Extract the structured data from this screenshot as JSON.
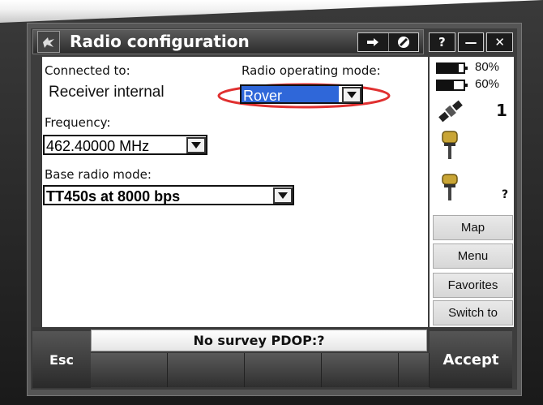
{
  "window": {
    "title": "Radio configuration",
    "status_icons": [
      "forward-arrow-icon",
      "no-entry-icon"
    ],
    "buttons": [
      "?",
      "—",
      "✕"
    ]
  },
  "fields": {
    "connected_to_label": "Connected to:",
    "connected_to_value": "Receiver internal",
    "operating_mode_label": "Radio operating mode:",
    "operating_mode_value": "Rover",
    "frequency_label": "Frequency:",
    "frequency_value": "462.40000 MHz",
    "base_radio_mode_label": "Base radio mode:",
    "base_radio_mode_value": "TT450s at 8000 bps"
  },
  "side_panel": {
    "battery1": "80%",
    "battery2": "60%",
    "satellites": "1",
    "receiver_status": "?",
    "buttons": [
      "Map",
      "Menu",
      "Favorites",
      "Switch to"
    ]
  },
  "bottom": {
    "status": "No survey  PDOP:?",
    "esc": "Esc",
    "accept": "Accept"
  },
  "colors": {
    "highlight": "#2f67d9",
    "annotation_ellipse": "#e03030"
  }
}
